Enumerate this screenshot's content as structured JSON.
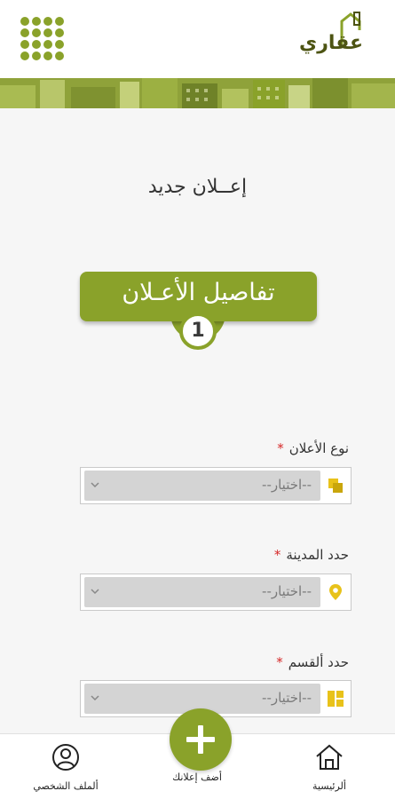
{
  "header": {
    "logo_text": "عقاري",
    "menu_icon": "grid-menu-icon",
    "accent_color": "#8aa22a"
  },
  "page": {
    "title": "إعــلان جديد"
  },
  "step": {
    "label": "تفاصيل الأعـلان",
    "number": "1"
  },
  "fields": [
    {
      "label": "نوع الأعلان",
      "required": "*",
      "placeholder": "--اختيار--",
      "icon": "category-icon"
    },
    {
      "label": "حدد المدينة",
      "required": "*",
      "placeholder": "--اختيار--",
      "icon": "location-pin-icon"
    },
    {
      "label": "حدد ألقسم",
      "required": "*",
      "placeholder": "--اختيار--",
      "icon": "section-grid-icon"
    }
  ],
  "bottom_nav": {
    "home": "ألرئيسية",
    "add": "أضف إعلانك",
    "profile": "ألملف الشخصي"
  }
}
